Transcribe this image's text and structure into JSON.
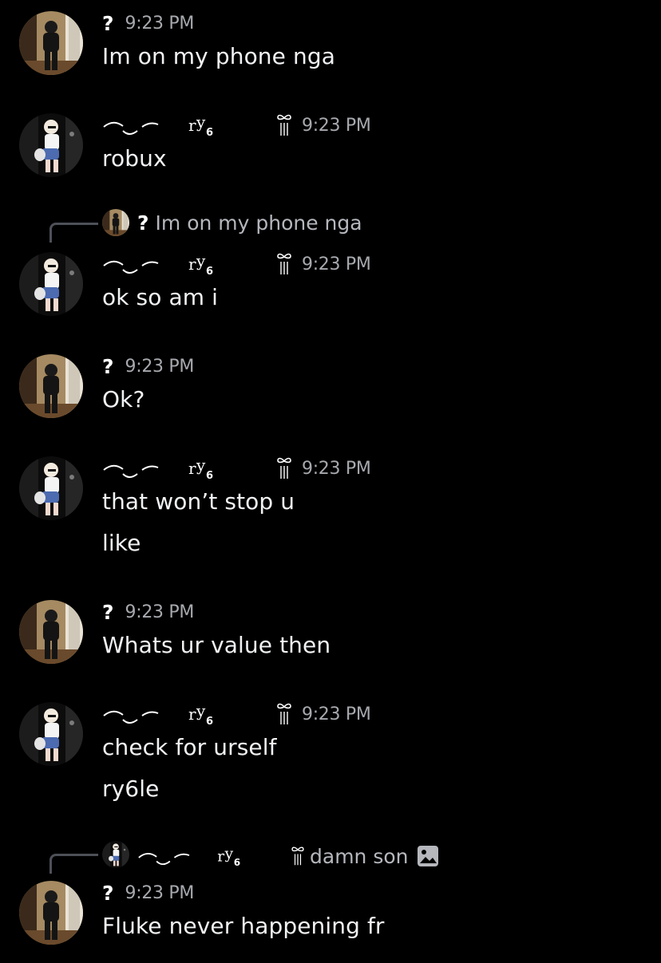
{
  "colors": {
    "background": "#000000",
    "message_text": "#f1f2f4",
    "timestamp": "#a7a9ae",
    "reply_text": "#b5b7bd",
    "reply_spine": "#4e5058"
  },
  "users": {
    "u1": {
      "name": "?",
      "avatar_icon": "avatar-dark-figure"
    },
    "u2": {
      "name_suffix": "ry6",
      "avatar_icon": "avatar-blonde-figure",
      "badge_icon": "bow-badge-icon"
    }
  },
  "messages": [
    {
      "user": "?",
      "time": "9:23 PM",
      "lines": [
        "Im on my phone nga"
      ]
    },
    {
      "user": "ry6",
      "time": "9:23 PM",
      "lines": [
        "robux"
      ]
    },
    {
      "reply_to": {
        "user": "?",
        "text": "Im on my phone nga"
      },
      "user": "ry6",
      "time": "9:23 PM",
      "lines": [
        "ok so am i"
      ]
    },
    {
      "user": "?",
      "time": "9:23 PM",
      "lines": [
        "Ok?"
      ]
    },
    {
      "user": "ry6",
      "time": "9:23 PM",
      "lines": [
        "that won’t stop u",
        "like"
      ]
    },
    {
      "user": "?",
      "time": "9:23 PM",
      "lines": [
        "Whats ur value then"
      ]
    },
    {
      "user": "ry6",
      "time": "9:23 PM",
      "lines": [
        "check for urself",
        "ry6le"
      ]
    },
    {
      "reply_to": {
        "user": "ry6",
        "text": "damn son",
        "icon": "image-icon"
      },
      "user": "?",
      "time": "9:23 PM",
      "lines": [
        "Fluke never happening fr"
      ]
    }
  ]
}
